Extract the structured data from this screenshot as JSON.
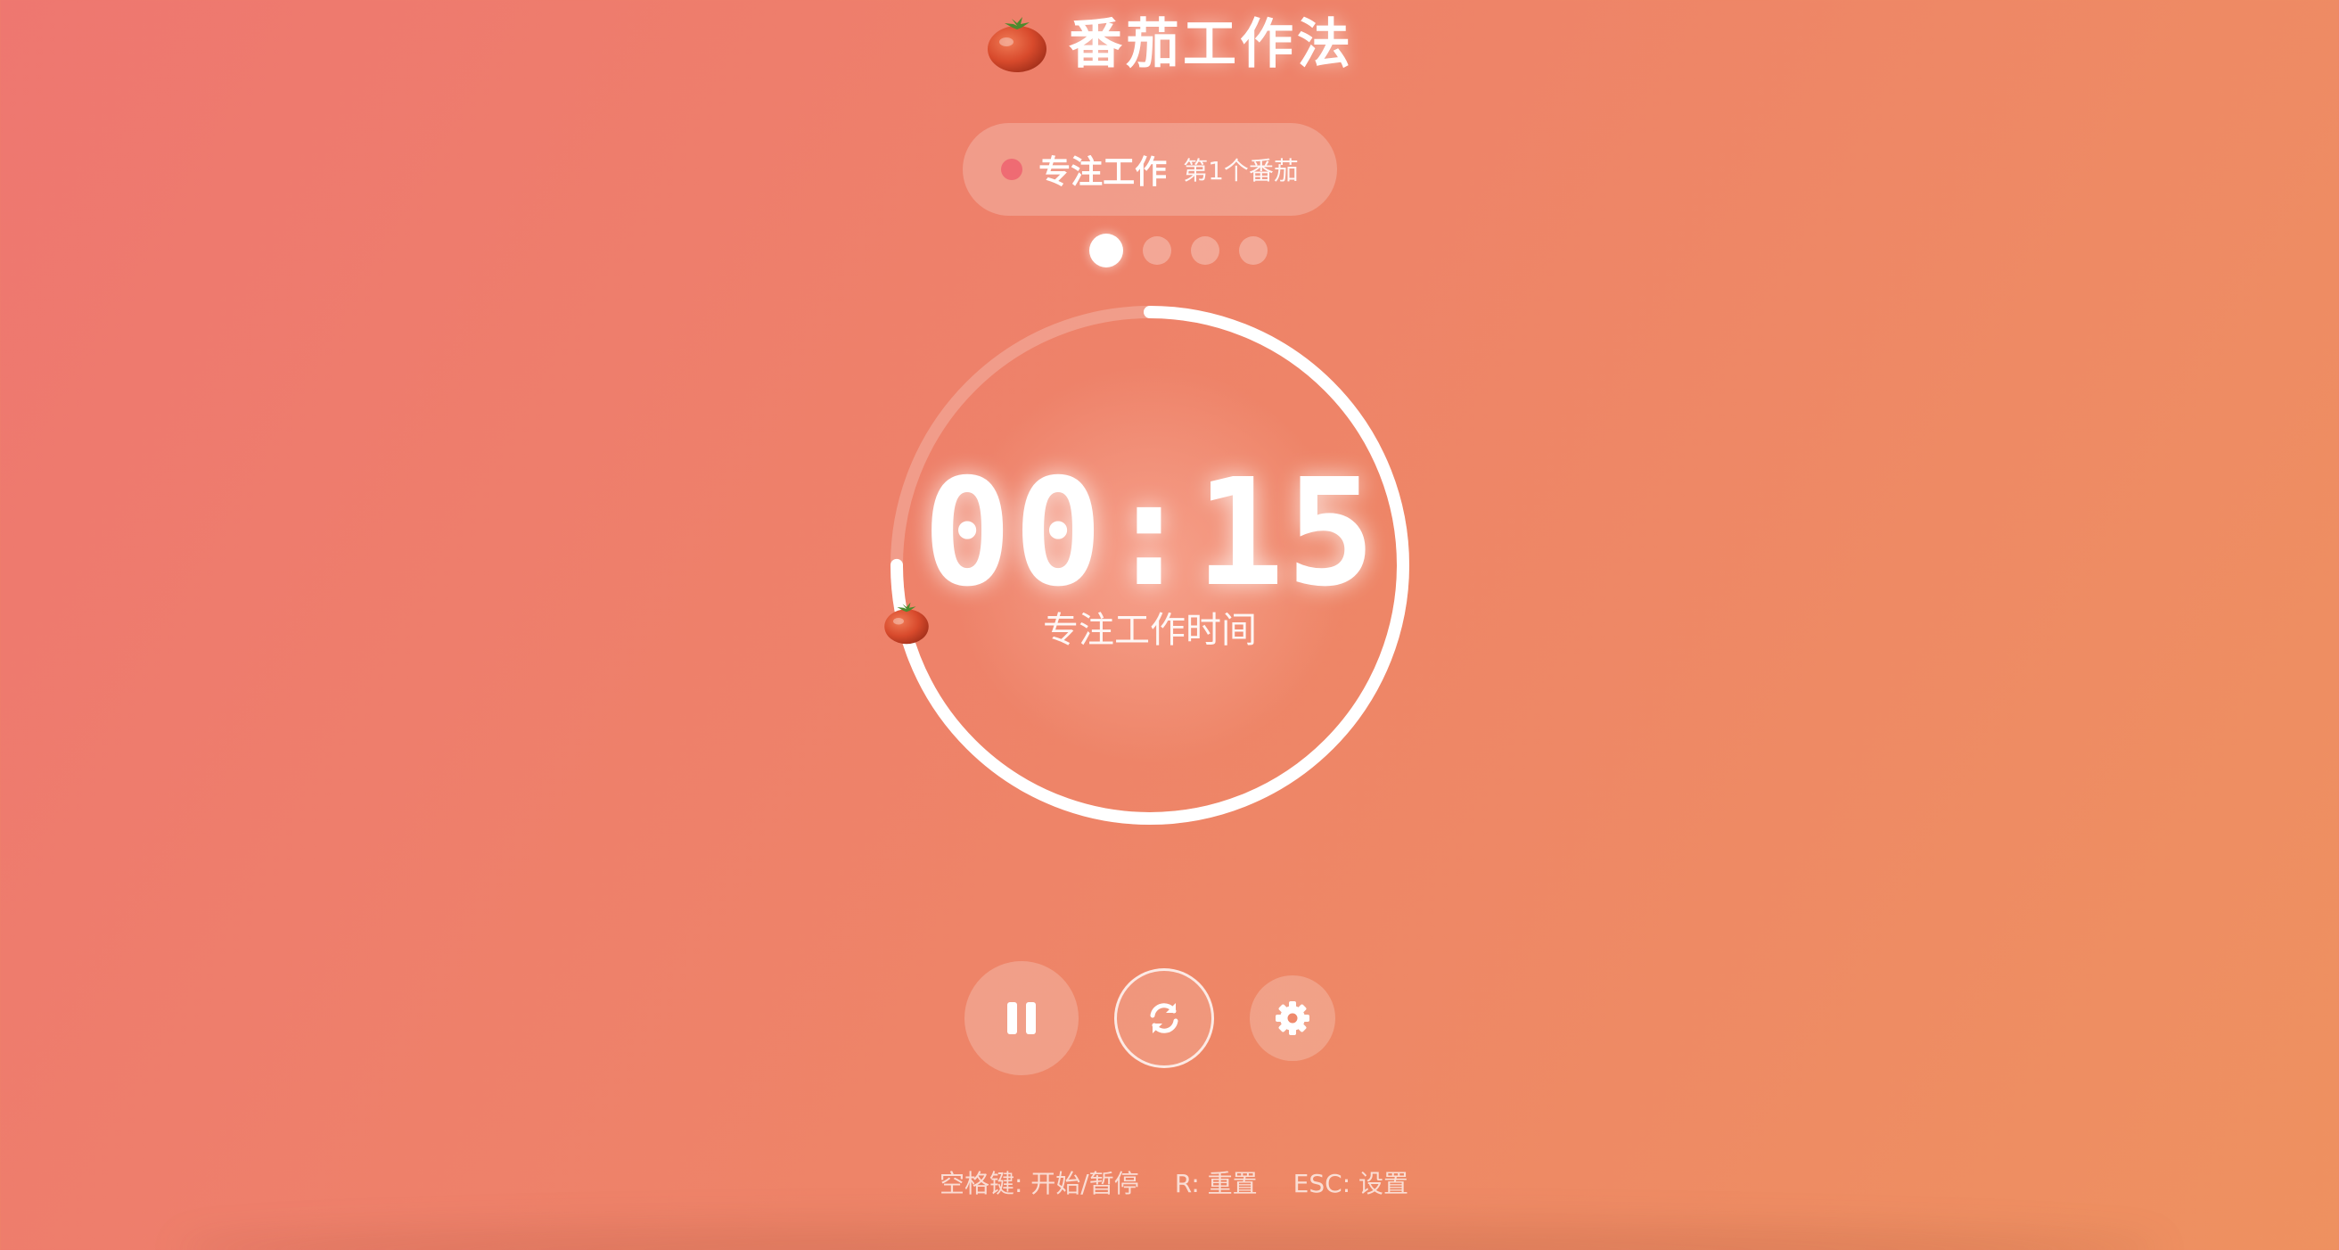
{
  "app": {
    "title": "番茄工作法",
    "logo_icon": "tomato-icon"
  },
  "session": {
    "label": "专注工作",
    "count": "第1个番茄",
    "status_color": "#ef6b73"
  },
  "rounds": {
    "total": 4,
    "current": 1
  },
  "timer": {
    "display": "00:15",
    "caption": "专注工作时间",
    "caption_icon": "tomato-icon",
    "progress_fraction": 0.75
  },
  "controls": {
    "pause_icon": "pause-icon",
    "reset_icon": "refresh-icon",
    "settings_icon": "gear-icon"
  },
  "shortcuts": [
    "空格键: 开始/暂停",
    "R: 重置",
    "ESC: 设置"
  ],
  "colors": {
    "bg_start": "#ee7770",
    "bg_end": "#ee9160",
    "accent_dot": "#ef6b73"
  }
}
